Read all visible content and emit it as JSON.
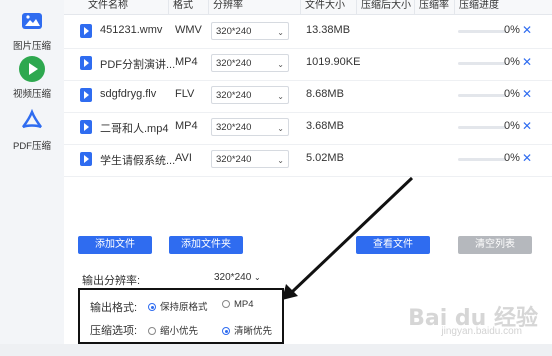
{
  "sidebar": {
    "items": [
      {
        "label": "图片压缩",
        "icon": "image-icon"
      },
      {
        "label": "视频压缩",
        "icon": "play-icon"
      },
      {
        "label": "PDF压缩",
        "icon": "pdf-icon"
      }
    ]
  },
  "table": {
    "headers": [
      "文件名称",
      "格式",
      "分辨率",
      "文件大小",
      "压缩后大小",
      "压缩率",
      "压缩进度"
    ],
    "rows": [
      {
        "name": "451231.wmv",
        "format": "WMV",
        "resolution": "320*240",
        "size": "13.38MB",
        "progress": "0%",
        "progress_value": 0
      },
      {
        "name": "PDF分割演讲...",
        "format": "MP4",
        "resolution": "320*240",
        "size": "1019.90KE",
        "progress": "0%",
        "progress_value": 0
      },
      {
        "name": "sdgfdryg.flv",
        "format": "FLV",
        "resolution": "320*240",
        "size": "8.68MB",
        "progress": "0%",
        "progress_value": 0
      },
      {
        "name": "二哥和人.mp4",
        "format": "MP4",
        "resolution": "320*240",
        "size": "3.68MB",
        "progress": "0%",
        "progress_value": 0
      },
      {
        "name": "学生请假系统...",
        "format": "AVI",
        "resolution": "320*240",
        "size": "5.02MB",
        "progress": "0%",
        "progress_value": 0
      }
    ]
  },
  "actions": {
    "add_file": "添加文件",
    "add_folder": "添加文件夹",
    "view_file": "查看文件",
    "clear_list": "清空列表"
  },
  "settings": {
    "output_resolution_label": "输出分辨率:",
    "output_resolution_value": "320*240",
    "output_format_label": "输出格式:",
    "format_options": [
      "保持原格式",
      "MP4"
    ],
    "compress_option_label": "压缩选项:",
    "compress_options": [
      "缩小优先",
      "清晰优先"
    ]
  },
  "watermark": {
    "text": "Bai du 经验",
    "sub": "jingyan.baidu.com"
  },
  "colors": {
    "accent": "#2f6cf0",
    "disabled": "#b5b8bd"
  }
}
